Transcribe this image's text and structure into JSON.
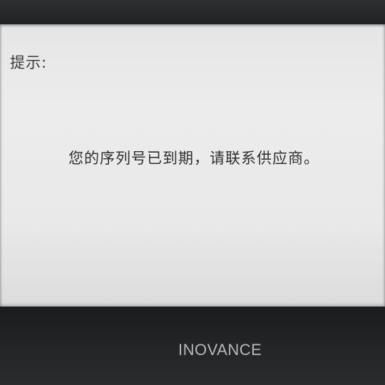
{
  "screen": {
    "title": "提示:",
    "message": "您的序列号已到期，请联系供应商。"
  },
  "device": {
    "brand": "INOVANCE"
  },
  "colors": {
    "screen_background": "#e9e9e9",
    "text": "#2f2f2f",
    "bezel": "#1d1e20",
    "brand_text": "#b8b8b8"
  }
}
